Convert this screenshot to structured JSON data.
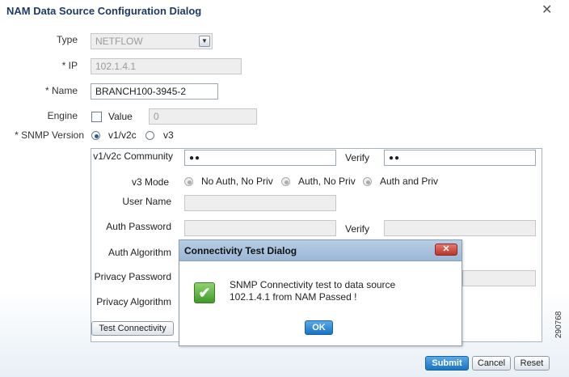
{
  "dialog": {
    "title": "NAM Data Source Configuration Dialog",
    "close_glyph": "✕"
  },
  "form": {
    "type_label": "Type",
    "type_value": "NETFLOW",
    "ip_label": "* IP",
    "ip_value": "102.1.4.1",
    "name_label": "* Name",
    "name_value": "BRANCH100-3945-2",
    "engine_label": "Engine",
    "value_label": "Value",
    "value_value": "0",
    "snmp_label": "* SNMP Version",
    "snmp_v1v2c": "v1/v2c",
    "snmp_v3": "v3"
  },
  "snmp": {
    "community_label": "v1/v2c Community",
    "community_value": "●●",
    "verify_label": "Verify",
    "verify_value": "●●",
    "v3mode_label": "v3 Mode",
    "mode_noauth": "No Auth, No Priv",
    "mode_auth": "Auth, No Priv",
    "mode_authpriv": "Auth and Priv",
    "username_label": "User Name",
    "authpass_label": "Auth Password",
    "authverify_label": "Verify",
    "authalg_label": "Auth Algorithm",
    "privpass_label": "Privacy Password",
    "privalg_label": "Privacy Algorithm",
    "test_button": "Test Connectivity"
  },
  "footer": {
    "submit": "Submit",
    "cancel": "Cancel",
    "reset": "Reset"
  },
  "modal": {
    "title": "Connectivity Test Dialog",
    "close_glyph": "✕",
    "message_line1": "SNMP Connectivity test to data source",
    "message_line2": "102.1.4.1 from NAM Passed !",
    "ok": "OK",
    "check_glyph": "✔"
  },
  "figure_id": "290768"
}
